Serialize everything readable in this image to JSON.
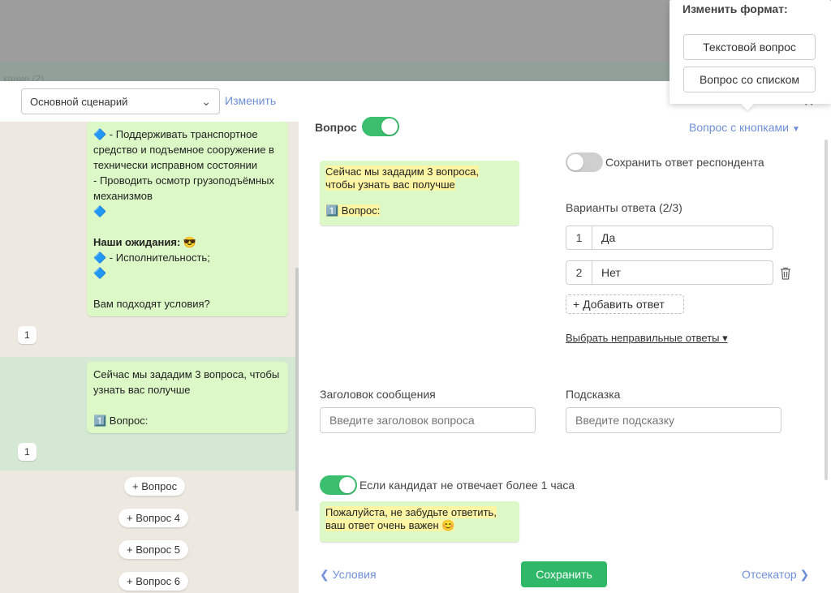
{
  "background": {
    "partial_text": "кание (2)"
  },
  "left": {
    "scenario_select": "Основной сценарий",
    "change_link": "Изменить",
    "bubble1": {
      "line1": "🔷 - Поддерживать транспортное средство и подъемное сооружение в технически исправном состоянии",
      "line2": "- Проводить осмотр грузоподъёмных механизмов",
      "line3": "🔷",
      "expect_bold": "Наши ожидания:",
      "expect_emoji": " 😎",
      "line5": "🔷 - Исполнительность;",
      "line6": "🔷",
      "line7": "Вам подходят условия?"
    },
    "chip1": "1",
    "bubble2": "Сейчас мы зададим 3 вопроса, чтобы узнать вас получше\n\n1️⃣ Вопрос:",
    "chip2": "1",
    "add_buttons": [
      "+ Вопрос",
      "+ Вопрос 4",
      "+ Вопрос 5",
      "+ Вопрос 6"
    ]
  },
  "editor": {
    "question_label": "Вопрос",
    "question_toggle_on": true,
    "question_type": "Вопрос с кнопками",
    "preview_line1": "Сейчас мы зададим 3 вопроса,",
    "preview_line2": "чтобы узнать вас получше",
    "preview_line3": "1️⃣ Вопрос:",
    "save_answer_label": "Сохранить ответ респондента",
    "save_answer_toggle_on": false,
    "answers_label": "Варианты ответа (2/3)",
    "answers": [
      {
        "num": "1",
        "text": "Да"
      },
      {
        "num": "2",
        "text": "Нет"
      }
    ],
    "add_answer": "+ Добавить ответ",
    "wrong_answers_link": "Выбрать неправильные ответы ▾",
    "header_label": "Заголовок сообщения",
    "header_placeholder": "Введите заголовок вопроса",
    "hint_label": "Подсказка",
    "hint_placeholder": "Введите подсказку",
    "timeout_label": "Если кандидат не отвечает более 1 часа",
    "timeout_toggle_on": true,
    "reminder_line1": "Пожалуйста, не забудьте ответить,",
    "reminder_line2": "ваш ответ очень важен 😊",
    "prev_link": "Условия",
    "save_button": "Сохранить",
    "next_link": "Отсекатор"
  },
  "popup": {
    "title": "Изменить формат:",
    "options": [
      "Текстовой вопрос",
      "Вопрос со списком"
    ]
  },
  "colors": {
    "accent_green": "#2fb868",
    "link_blue": "#6f8fd8",
    "bubble_green": "#dcf8c6"
  }
}
